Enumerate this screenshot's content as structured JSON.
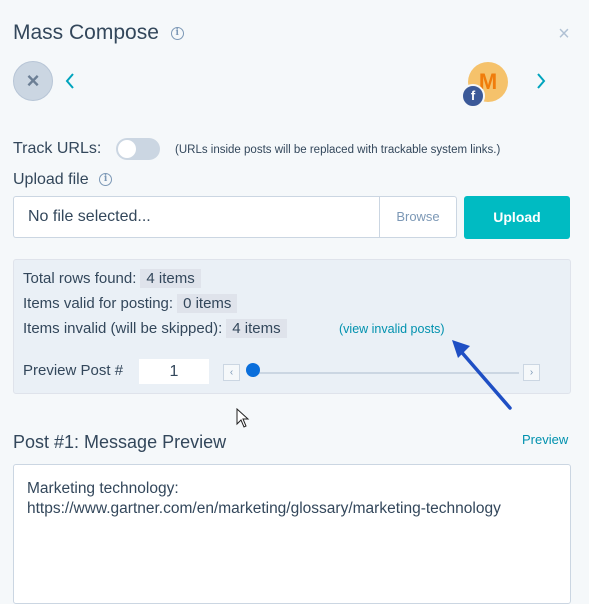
{
  "header": {
    "title": "Mass Compose",
    "close_label": "×"
  },
  "accounts": {
    "remove_label": "×",
    "avatar_letter": "M",
    "network_badge": "f",
    "prev_icon": "chevron-left-icon",
    "next_icon": "chevron-right-icon"
  },
  "track_urls": {
    "label": "Track URLs:",
    "enabled": false,
    "hint": "(URLs inside posts will be replaced with trackable system links.)"
  },
  "upload": {
    "label": "Upload file",
    "file_value": "No file selected...",
    "browse_label": "Browse",
    "upload_label": "Upload"
  },
  "summary": {
    "total_label": "Total rows found:",
    "total_value": "4 items",
    "valid_label": "Items valid for posting:",
    "valid_value": "0 items",
    "invalid_label": "Items invalid (will be skipped):",
    "invalid_value": "4 items",
    "invalid_link": "(view invalid posts)"
  },
  "preview_control": {
    "label": "Preview Post #",
    "value": "1",
    "slider_position": 0
  },
  "message_preview": {
    "title": "Post #1: Message Preview",
    "preview_link": "Preview",
    "lines": [
      "Marketing technology:",
      "https://www.gartner.com/en/marketing/glossary/marketing-technology"
    ]
  },
  "colors": {
    "accent": "#00bbc2",
    "link": "#0091ae",
    "annotation_arrow": "#1f4fc4"
  }
}
